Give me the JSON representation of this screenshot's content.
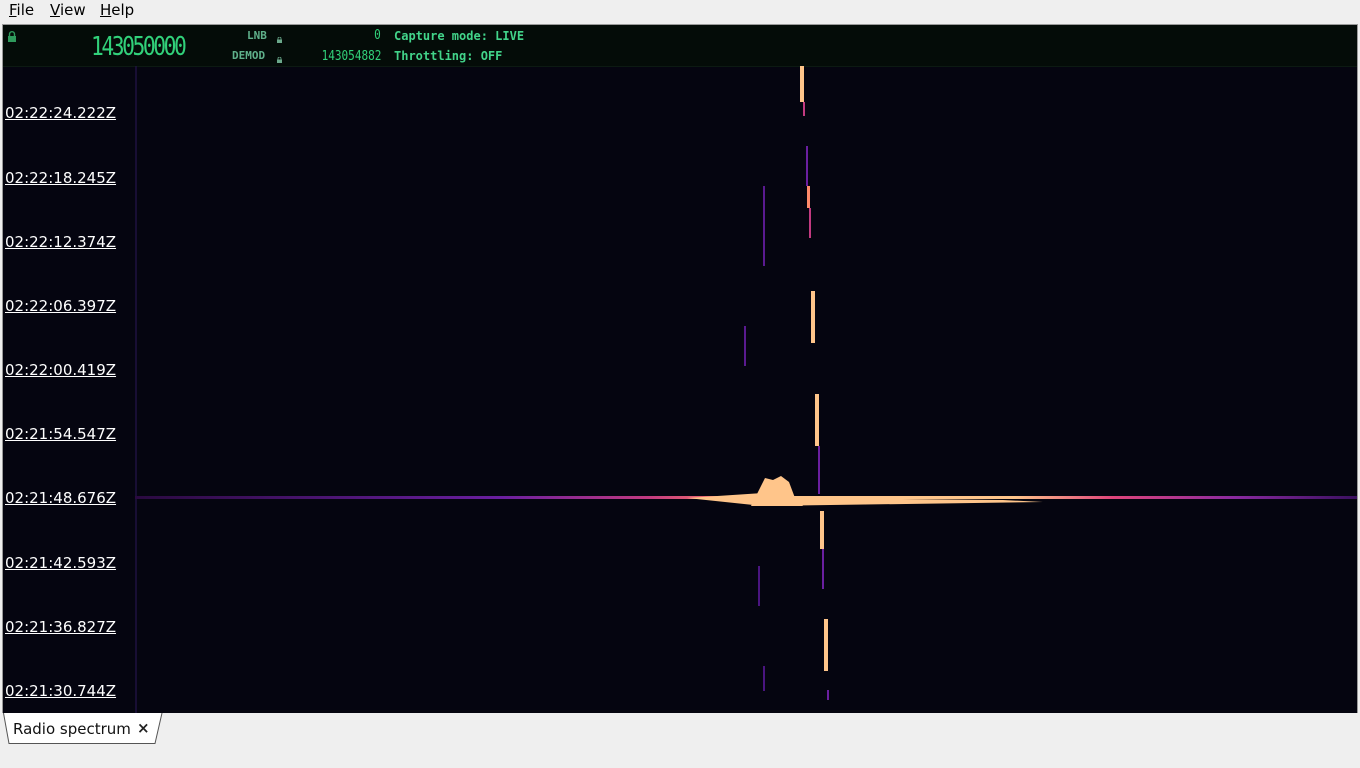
{
  "menu": {
    "items": [
      {
        "label": "File",
        "mnemonic": "F",
        "rest": "ile"
      },
      {
        "label": "View",
        "mnemonic": "V",
        "rest": "iew"
      },
      {
        "label": "Help",
        "mnemonic": "H",
        "rest": "elp"
      }
    ]
  },
  "header": {
    "frequency": "143050000",
    "lnb_label": "LNB",
    "lnb_value": "0",
    "demod_label": "DEMOD",
    "demod_value": "143054882",
    "capture_mode": "Capture mode: LIVE",
    "throttling": "Throttling: OFF",
    "accent_color": "#31d17a"
  },
  "waterfall": {
    "timestamps": [
      "02:22:24.222Z",
      "02:22:18.245Z",
      "02:22:12.374Z",
      "02:22:06.397Z",
      "02:22:00.419Z",
      "02:21:54.547Z",
      "02:21:48.676Z",
      "02:21:42.593Z",
      "02:21:36.827Z",
      "02:21:30.744Z"
    ],
    "background_color": "#050510",
    "signal_color_hot": "#ffc58a",
    "signal_color_mid": "#e0457b",
    "signal_color_low": "#6a1fa0"
  },
  "tabs": [
    {
      "label": "Radio spectrum",
      "close": "×"
    }
  ]
}
